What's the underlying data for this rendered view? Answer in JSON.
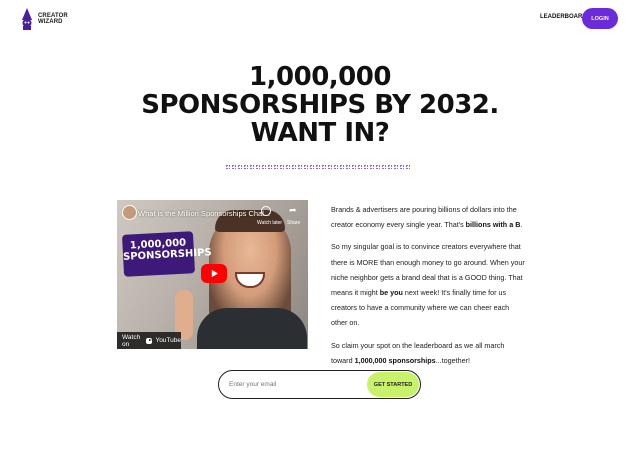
{
  "header": {
    "brand_line1": "CREATOR",
    "brand_line2": "WIZARD",
    "nav_leaderboard": "LEADERBOARD",
    "login_label": "LOGIN"
  },
  "hero": {
    "line1": "1,000,000",
    "line2": "SPONSORSHIPS BY 2032.",
    "line3": "WANT IN?"
  },
  "video": {
    "title": "What is the Million Sponsorships Chal...",
    "watch_later": "Watch later",
    "share": "Share",
    "badge_line1": "1,000,000",
    "badge_line2": "SPONSORSHIPS",
    "watch_on": "Watch on",
    "youtube": "YouTube"
  },
  "copy": {
    "p1_before": "Brands & advertisers are pouring billions of dollars into the creator economy every single year. That's ",
    "p1_bold": "billions with a B",
    "p1_after": ".",
    "p2_part1": "So my singular goal is to convince creators everywhere that there is MORE than enough money to go around. When your niche neighbor gets a brand deal that is a GOOD thing. That means it might ",
    "p2_bold": "be you",
    "p2_part2": " next week! It's finally time for us creators to have a community where we can cheer each other on.",
    "p3_before": "So claim your spot on the leaderboard as we all march toward ",
    "p3_bold": "1,000,000 sponsorships",
    "p3_after": "...together!"
  },
  "form": {
    "email_placeholder": "Enter your email",
    "submit_label": "GET STARTED"
  },
  "colors": {
    "brand_purple": "#6b2bd9",
    "cta_green": "#c9f26b",
    "play_red": "#ff0000"
  }
}
